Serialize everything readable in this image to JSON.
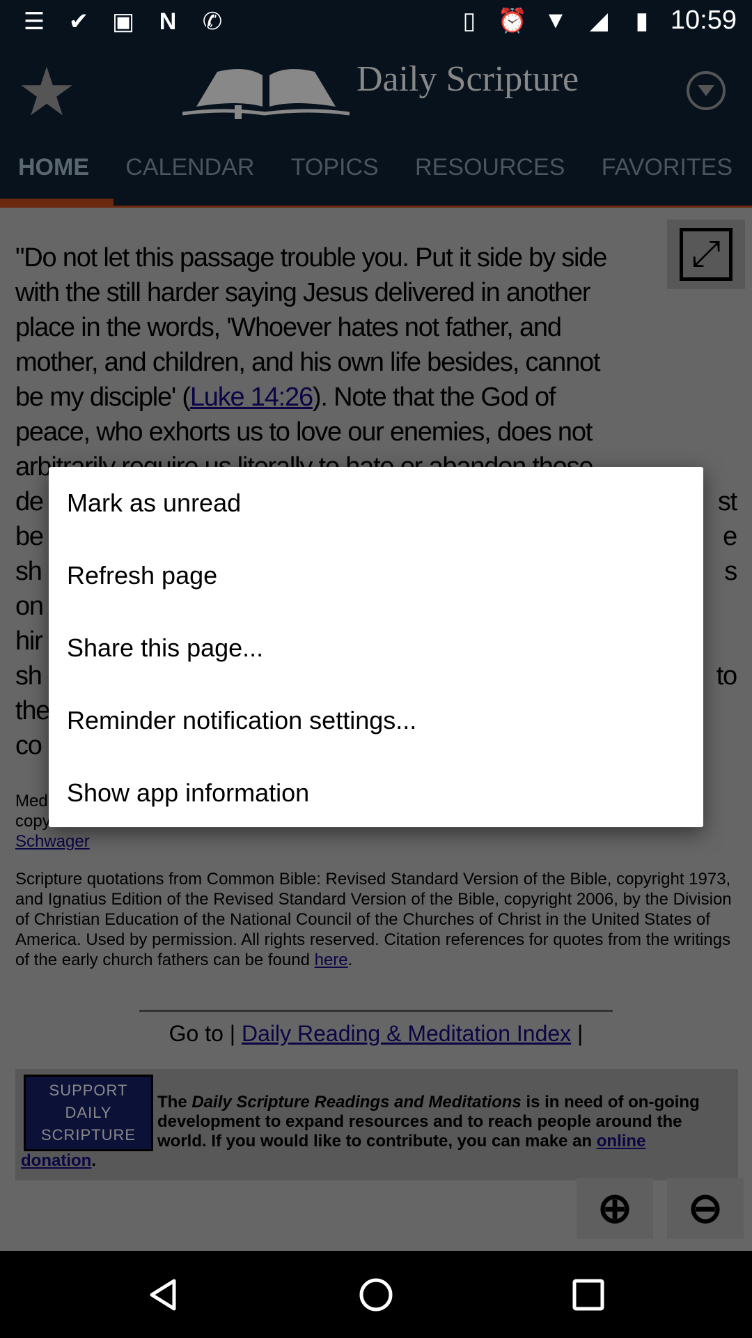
{
  "status_bar": {
    "left_icons": [
      "notes-icon",
      "tasks-check-icon",
      "image-icon",
      "n-app-icon",
      "whatsapp-icon"
    ],
    "right_icons": [
      "vibrate-icon",
      "alarm-icon",
      "wifi-icon",
      "signal-icon",
      "battery-charging-icon"
    ],
    "time": "10:59"
  },
  "header": {
    "title": "Daily Scripture",
    "tabs": [
      {
        "label": "HOME",
        "active": true
      },
      {
        "label": "CALENDAR"
      },
      {
        "label": "TOPICS"
      },
      {
        "label": "RESOURCES"
      },
      {
        "label": "FAVORITES"
      }
    ],
    "accent": "#d4541f"
  },
  "article": {
    "lines": [
      "\"Do not let this passage trouble you. Put it side by side",
      "with the still harder saying Jesus delivered in another",
      "place in the words, 'Whoever hates not father, and",
      "mother, and children, and his own life besides, cannot",
      {
        "pre": "be my disciple' (",
        "link": "Luke 14:26",
        "post": "). Note that the God of"
      },
      "peace, who exhorts us to love our enemies, does not",
      "arbitrarily require us literally to hate or abandon those"
    ],
    "fragments": [
      {
        "l": "de",
        "r": "st"
      },
      {
        "l": "be",
        "r": "e"
      },
      {
        "l": "sh",
        "r": "s"
      },
      {
        "l": "on",
        "r": ""
      },
      {
        "l": "hir",
        "r": ""
      },
      {
        "l": "sh",
        "r": "to"
      },
      {
        "l": "the",
        "r": ""
      },
      {
        "l": "co",
        "r": ""
      }
    ],
    "credit_fragments": {
      "line1": "Med",
      "line2": "copy",
      "author_link": "Schwager"
    },
    "scripture_notice": "Scripture quotations from Common Bible: Revised Standard Version of the Bible, copyright 1973, and Ignatius Edition of the Revised Standard Version of the Bible, copyright 2006, by the Division of Christian Education of the National Council of the Churches of Christ in the United States of America. Used by permission. All rights reserved.  Citation references for quotes from the writings of the early church fathers can be found ",
    "here_link": "here",
    "goto_prefix": "Go to | ",
    "goto_link": "Daily Reading & Meditation Index",
    "goto_suffix": " |",
    "support": {
      "badge": [
        "SUPPORT",
        "DAILY",
        "SCRIPTURE"
      ],
      "text_pre": "The ",
      "text_italic": "Daily Scripture Readings and Meditations",
      "text_post": " is in need of on-going development to expand resources and to reach people around the world. If you would like to contribute, you can make an ",
      "link1": "online",
      "link2": "donation"
    }
  },
  "dialog": {
    "items": [
      "Mark as unread",
      "Refresh page",
      "Share this page...",
      "Reminder notification settings...",
      "Show app information"
    ]
  },
  "nav": {
    "icons": [
      "back-icon",
      "home-icon",
      "recents-icon"
    ]
  }
}
